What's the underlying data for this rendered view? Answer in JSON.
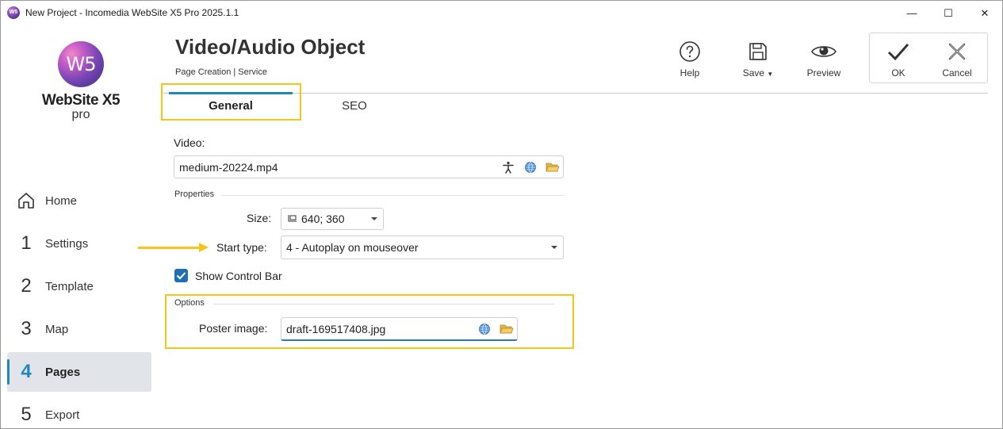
{
  "window": {
    "title": "New Project - Incomedia WebSite X5 Pro 2025.1.1",
    "app_icon_text": "W5",
    "controls": {
      "minimize": "—",
      "maximize": "☐",
      "close": "✕"
    }
  },
  "logo": {
    "mark": "W5",
    "name": "WebSite X5",
    "edition": "pro"
  },
  "sidebar": {
    "items": [
      {
        "number": "",
        "icon": "home-icon",
        "label": "Home"
      },
      {
        "number": "1",
        "label": "Settings"
      },
      {
        "number": "2",
        "label": "Template"
      },
      {
        "number": "3",
        "label": "Map"
      },
      {
        "number": "4",
        "label": "Pages",
        "active": true
      },
      {
        "number": "5",
        "label": "Export"
      }
    ]
  },
  "header": {
    "title": "Video/Audio Object",
    "breadcrumb": "Page Creation | Service"
  },
  "toolbar": {
    "help": "Help",
    "save": "Save",
    "preview": "Preview",
    "ok": "OK",
    "cancel": "Cancel"
  },
  "tabs": [
    {
      "label": "General",
      "active": true
    },
    {
      "label": "SEO",
      "active": false
    }
  ],
  "form": {
    "video_label": "Video:",
    "video_value": "medium-20224.mp4",
    "properties_label": "Properties",
    "size_label": "Size:",
    "size_value": "640; 360",
    "start_type_label": "Start type:",
    "start_type_value": "4 - Autoplay on mouseover",
    "show_control_bar_label": "Show Control Bar",
    "show_control_bar_checked": true,
    "options_label": "Options",
    "poster_label": "Poster image:",
    "poster_value": "draft-169517408.jpg"
  },
  "colors": {
    "accent": "#1f86c1",
    "highlight": "#f5c518",
    "checkbox": "#1f6fb4"
  }
}
